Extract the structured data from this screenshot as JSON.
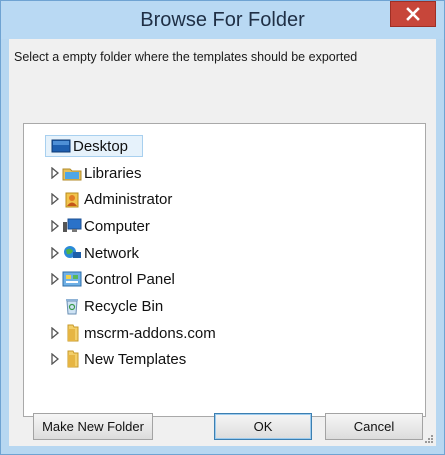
{
  "dialog": {
    "title": "Browse For Folder",
    "instruction": "Select a empty folder where the templates should be exported"
  },
  "tree": {
    "items": [
      {
        "label": "Desktop",
        "icon": "desktop-icon",
        "expandable": false,
        "selected": true
      },
      {
        "label": "Libraries",
        "icon": "libraries-icon",
        "expandable": true
      },
      {
        "label": "Administrator",
        "icon": "user-folder-icon",
        "expandable": true
      },
      {
        "label": "Computer",
        "icon": "computer-icon",
        "expandable": true
      },
      {
        "label": "Network",
        "icon": "network-icon",
        "expandable": true
      },
      {
        "label": "Control Panel",
        "icon": "control-panel-icon",
        "expandable": true
      },
      {
        "label": "Recycle Bin",
        "icon": "recycle-bin-icon",
        "expandable": false
      },
      {
        "label": "mscrm-addons.com",
        "icon": "folder-icon",
        "expandable": true
      },
      {
        "label": "New Templates",
        "icon": "folder-icon",
        "expandable": true,
        "highlighted": true
      }
    ]
  },
  "buttons": {
    "make_new_folder": "Make New Folder",
    "ok": "OK",
    "cancel": "Cancel"
  },
  "colors": {
    "titlebar": "#b9d9f3",
    "close": "#c7463a",
    "highlight": "#fff31c"
  }
}
